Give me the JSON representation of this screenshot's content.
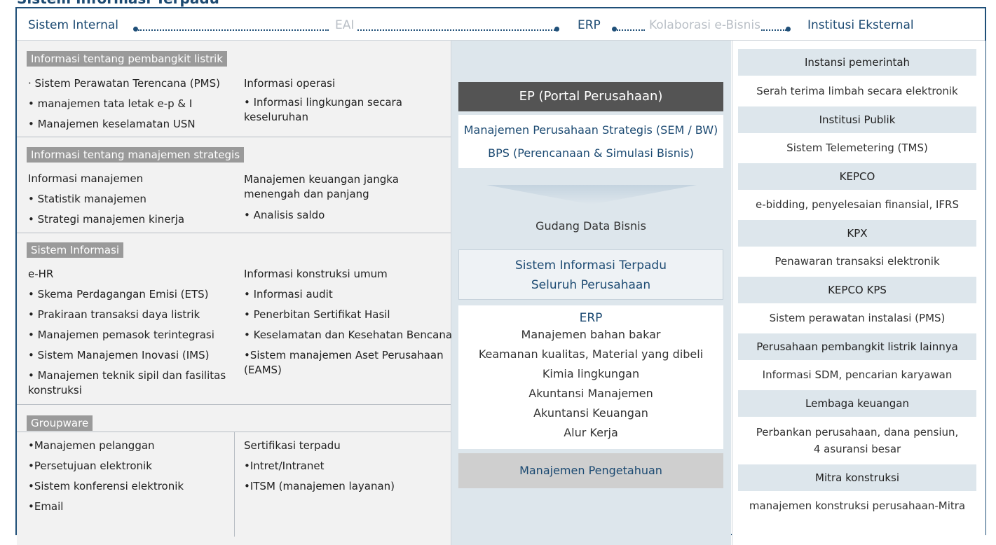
{
  "title": "Sistem Informasi Terpadu",
  "header": {
    "internal": "Sistem Internal",
    "eai": "EAI",
    "erp": "ERP",
    "kolaborasi": "Kolaborasi e-Bisnis",
    "eksternal": "Institusi Eksternal"
  },
  "colors": {
    "navy": "#1f4f78",
    "section_header": "#9a9a9a",
    "middle_bg": "#dde6ec",
    "ep_bg": "#545454"
  },
  "left": {
    "s1": {
      "header": "Informasi tentang pembangkit listrik",
      "col1": [
        "· Sistem Perawatan Terencana (PMS)",
        "• manajemen tata letak e-p & I",
        "• Manajemen keselamatan USN"
      ],
      "col2_0": "Informasi operasi",
      "col2_1": "• Informasi lingkungan secara keseluruhan"
    },
    "s2": {
      "header": "Informasi tentang manajemen strategis",
      "col1": [
        "Informasi manajemen",
        "• Statistik manajemen",
        "• Strategi manajemen kinerja"
      ],
      "col2_0": "Manajemen keuangan jangka menengah dan panjang",
      "col2_1": "• Analisis saldo"
    },
    "s3": {
      "header": "Sistem Informasi",
      "col1": [
        "e-HR",
        "• Skema Perdagangan Emisi (ETS)",
        "• Prakiraan transaksi daya listrik",
        "• Manajemen pemasok terintegrasi",
        "• Sistem Manajemen Inovasi (IMS)"
      ],
      "col1_wrap": "• Manajemen teknik sipil dan fasilitas konstruksi",
      "col2": [
        "Informasi konstruksi umum",
        "• Informasi audit",
        "• Penerbitan Sertifikat Hasil",
        "• Keselamatan dan Kesehatan Bencana"
      ],
      "col2_wrap": "•Sistem manajemen Aset Perusahaan (EAMS)"
    },
    "s4": {
      "header": "Groupware",
      "col1": [
        "•Manajemen pelanggan",
        "•Persetujuan elektronik",
        "•Sistem konferensi elektronik",
        "•Email"
      ],
      "col2": [
        "Sertifikasi terpadu",
        "•Intret/Intranet",
        "•ITSM (manajemen layanan)"
      ]
    }
  },
  "middle": {
    "ep": "EP (Portal Perusahaan)",
    "sem": "Manajemen Perusahaan Strategis (SEM / BW)",
    "bps": "BPS (Perencanaan & Simulasi Bisnis)",
    "gudang": "Gudang Data Bisnis",
    "sitp1": "Sistem Informasi Terpadu",
    "sitp2": "Seluruh Perusahaan",
    "erp_title": "ERP",
    "erp_items": [
      "Manajemen bahan bakar",
      "Keamanan kualitas, Material yang dibeli",
      "Kimia lingkungan",
      "Akuntansi Manajemen",
      "Akuntansi Keuangan",
      "Alur Kerja"
    ],
    "km": "Manajemen Pengetahuan"
  },
  "right": [
    {
      "header": "Instansi pemerintah",
      "text": "Serah terima limbah secara elektronik"
    },
    {
      "header": "Institusi Publik",
      "text": "Sistem Telemetering (TMS)"
    },
    {
      "header": "KEPCO",
      "text": "e-bidding, penyelesaian finansial, IFRS"
    },
    {
      "header": "KPX",
      "text": "Penawaran transaksi elektronik"
    },
    {
      "header": "KEPCO KPS",
      "text": "Sistem perawatan instalasi (PMS)"
    },
    {
      "header": "Perusahaan pembangkit listrik lainnya",
      "text": "Informasi SDM, pencarian karyawan"
    },
    {
      "header": "Lembaga keuangan",
      "text": "Perbankan perusahaan, dana pensiun,",
      "text2": "4 asuransi besar"
    },
    {
      "header": "Mitra konstruksi",
      "text": "manajemen konstruksi perusahaan-Mitra"
    }
  ]
}
